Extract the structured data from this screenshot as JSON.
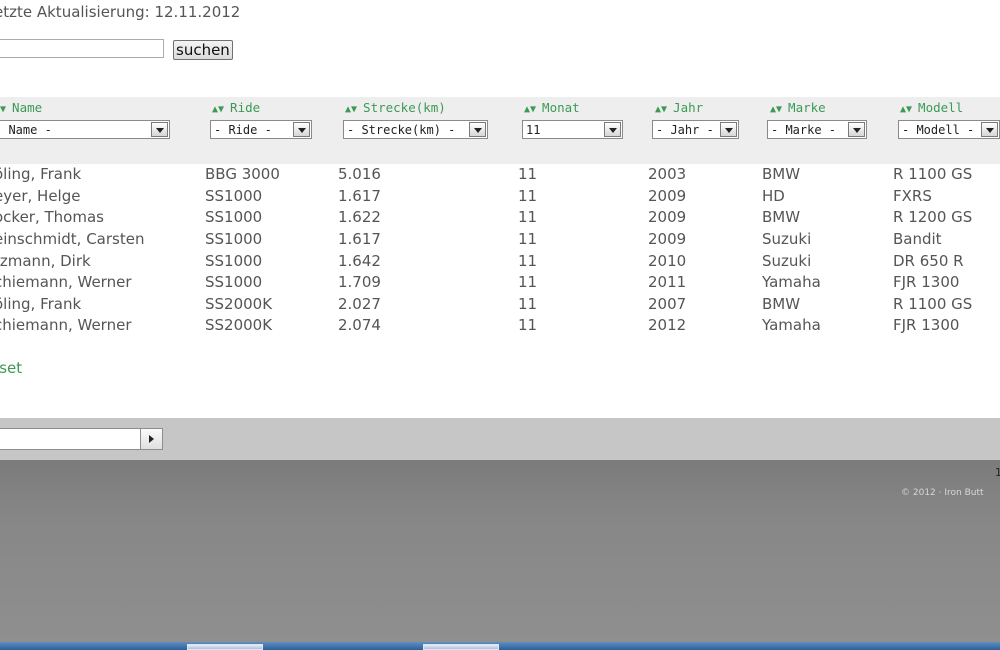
{
  "header": {
    "last_updated": "etzte Aktualisierung: 12.11.2012"
  },
  "search": {
    "value": "",
    "button_label": "suchen"
  },
  "columns": [
    {
      "label": "Name",
      "filter": "- Name -"
    },
    {
      "label": "Ride",
      "filter": "- Ride -"
    },
    {
      "label": "Strecke(km)",
      "filter": "- Strecke(km) -"
    },
    {
      "label": "Monat",
      "filter": "11"
    },
    {
      "label": "Jahr",
      "filter": "- Jahr -"
    },
    {
      "label": "Marke",
      "filter": "- Marke -"
    },
    {
      "label": "Modell",
      "filter": "- Modell -"
    }
  ],
  "sort_arrows": "▲▼",
  "rows": [
    [
      "öling, Frank",
      "BBG 3000",
      "5.016",
      "11",
      "2003",
      "BMW",
      "R 1100 GS"
    ],
    [
      "eyer, Helge",
      "SS1000",
      "1.617",
      "11",
      "2009",
      "HD",
      "FXRS"
    ],
    [
      "ocker, Thomas",
      "SS1000",
      "1.622",
      "11",
      "2009",
      "BMW",
      "R 1200 GS"
    ],
    [
      "einschmidt, Carsten",
      "SS1000",
      "1.617",
      "11",
      "2009",
      "Suzuki",
      "Bandit"
    ],
    [
      "tzmann, Dirk",
      "SS1000",
      "1.642",
      "11",
      "2010",
      "Suzuki",
      "DR 650 R"
    ],
    [
      "chiemann, Werner",
      "SS1000",
      "1.709",
      "11",
      "2011",
      "Yamaha",
      "FJR 1300"
    ],
    [
      "öling, Frank",
      "SS2000K",
      "2.027",
      "11",
      "2007",
      "BMW",
      "R 1100 GS"
    ],
    [
      "chiemann, Werner",
      "SS2000K",
      "2.074",
      "11",
      "2012",
      "Yamaha",
      "FJR 1300"
    ]
  ],
  "reset_label": "eset",
  "footer": {
    "page_number": "1",
    "copyright": "© 2012 · Iron Butt"
  },
  "colors": {
    "accent_green": "#3c9a55",
    "text_gray": "#555555",
    "filter_band": "#eeeeee",
    "footer_light": "#c6c6c6",
    "footer_dark": "#878787"
  }
}
